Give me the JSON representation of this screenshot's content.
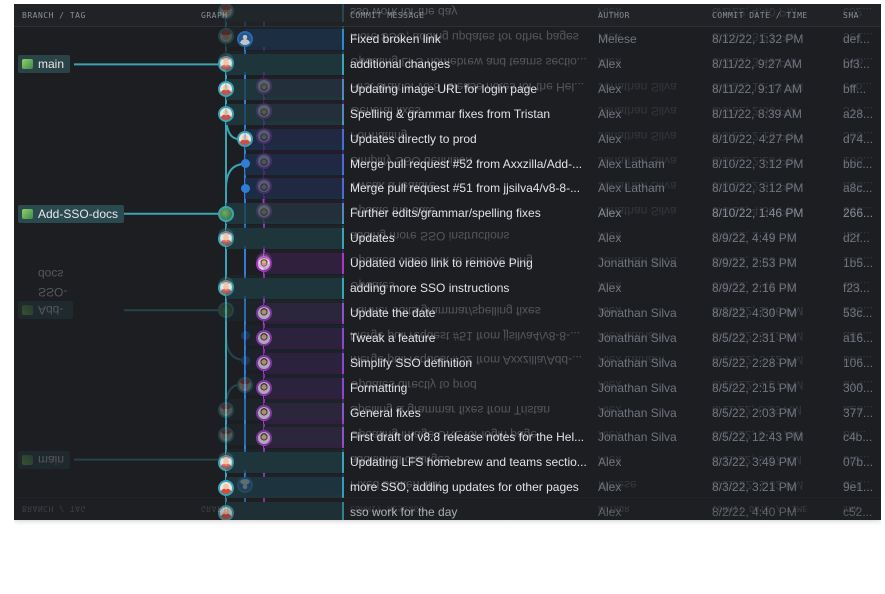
{
  "columns": {
    "branch": "BRANCH / TAG",
    "graph": "GRAPH",
    "message": "COMMIT MESSAGE",
    "author": "AUTHOR",
    "date": "COMMIT DATE / TIME",
    "sha": "SHA"
  },
  "branches": [
    {
      "label": "main",
      "row": 1
    },
    {
      "label": "Add-SSO-docs",
      "row": 7
    }
  ],
  "colors": {
    "teal": "#3aa4b4",
    "blue": "#2f7dd6",
    "purple": "#a638c9",
    "panel": "#1c1e22"
  },
  "commits": [
    {
      "message": "Fixed broken link",
      "author": "Melese",
      "date": "8/12/22, 1:32 PM",
      "sha": "def...",
      "avatar": "mel",
      "lane": 1,
      "stripe": "blue"
    },
    {
      "message": "additional changes",
      "author": "Alex",
      "date": "8/11/22, 9:27 AM",
      "sha": "bf3...",
      "avatar": "alex",
      "lane": 0,
      "stripe": "teal"
    },
    {
      "message": "Updating image URL for login page",
      "author": "Alex",
      "date": "8/11/22, 9:17 AM",
      "sha": "bff...",
      "avatar": "alex",
      "lane": 0,
      "stripe": "teal"
    },
    {
      "message": "Spelling & grammar fixes from Tristan",
      "author": "Alex",
      "date": "8/11/22, 8:39 AM",
      "sha": "a28...",
      "avatar": "alex",
      "lane": 0,
      "stripe": "teal"
    },
    {
      "message": "Updates directly to prod",
      "author": "Alex",
      "date": "8/10/22, 4:27 PM",
      "sha": "d74...",
      "avatar": "alex",
      "lane": 1,
      "stripe": "blue"
    },
    {
      "message": "Merge pull request #52 from Axxzilla/Add-...",
      "author": "Alex Latham",
      "date": "8/10/22, 3:12 PM",
      "sha": "bbc...",
      "avatar": "dot",
      "lane": 1,
      "stripe": "blue"
    },
    {
      "message": "Merge pull request #51 from jjsilva4/v8-8-...",
      "author": "Alex Latham",
      "date": "8/10/22, 3:12 PM",
      "sha": "a8c...",
      "avatar": "dot",
      "lane": 1,
      "stripe": "blue"
    },
    {
      "message": "Further edits/grammar/spelling fixes",
      "author": "Alex",
      "date": "8/10/22, 1:46 PM",
      "sha": "266...",
      "avatar": "green",
      "lane": 0,
      "stripe": "teal",
      "selected": true
    },
    {
      "message": "Updates",
      "author": "Alex",
      "date": "8/9/22, 4:49 PM",
      "sha": "d2f...",
      "avatar": "alex",
      "lane": 0,
      "stripe": "teal"
    },
    {
      "message": "Updated video link to remove Ping",
      "author": "Jonathan Silva",
      "date": "8/9/22, 2:53 PM",
      "sha": "1b5...",
      "avatar": "jon",
      "lane": 2,
      "stripe": "purple"
    },
    {
      "message": "adding more SSO instructions",
      "author": "Alex",
      "date": "8/9/22, 2:16 PM",
      "sha": "f23...",
      "avatar": "alex",
      "lane": 0,
      "stripe": "teal"
    },
    {
      "message": "Update the date",
      "author": "Jonathan Silva",
      "date": "8/8/22, 4:30 PM",
      "sha": "53c...",
      "avatar": "jon",
      "lane": 2,
      "stripe": "purple"
    },
    {
      "message": "Tweak a feature",
      "author": "Jonathan Silva",
      "date": "8/5/22, 2:31 PM",
      "sha": "a16...",
      "avatar": "jon",
      "lane": 2,
      "stripe": "purple"
    },
    {
      "message": "Simplify SSO definition",
      "author": "Jonathan Silva",
      "date": "8/5/22, 2:28 PM",
      "sha": "106...",
      "avatar": "jon",
      "lane": 2,
      "stripe": "purple"
    },
    {
      "message": "Formatting",
      "author": "Jonathan Silva",
      "date": "8/5/22, 2:15 PM",
      "sha": "300...",
      "avatar": "jon",
      "lane": 2,
      "stripe": "purple"
    },
    {
      "message": "General fixes",
      "author": "Jonathan Silva",
      "date": "8/5/22, 2:03 PM",
      "sha": "377...",
      "avatar": "jon",
      "lane": 2,
      "stripe": "purple"
    },
    {
      "message": "First draft of v8.8 release notes for the Hel...",
      "author": "Jonathan Silva",
      "date": "8/5/22, 12:43 PM",
      "sha": "c4b...",
      "avatar": "jon",
      "lane": 2,
      "stripe": "purple"
    },
    {
      "message": "Updating LFS homebrew and teams sectio...",
      "author": "Alex",
      "date": "8/3/22, 3:49 PM",
      "sha": "07b...",
      "avatar": "alex",
      "lane": 0,
      "stripe": "teal"
    },
    {
      "message": "more SSO, adding updates for other pages",
      "author": "Alex",
      "date": "8/3/22, 3:21 PM",
      "sha": "9e1...",
      "avatar": "alex",
      "lane": 0,
      "stripe": "teal"
    },
    {
      "message": "sso work for the day",
      "author": "Alex",
      "date": "8/2/22, 4:40 PM",
      "sha": "c52...",
      "avatar": "alex",
      "lane": 0,
      "stripe": "teal"
    }
  ]
}
